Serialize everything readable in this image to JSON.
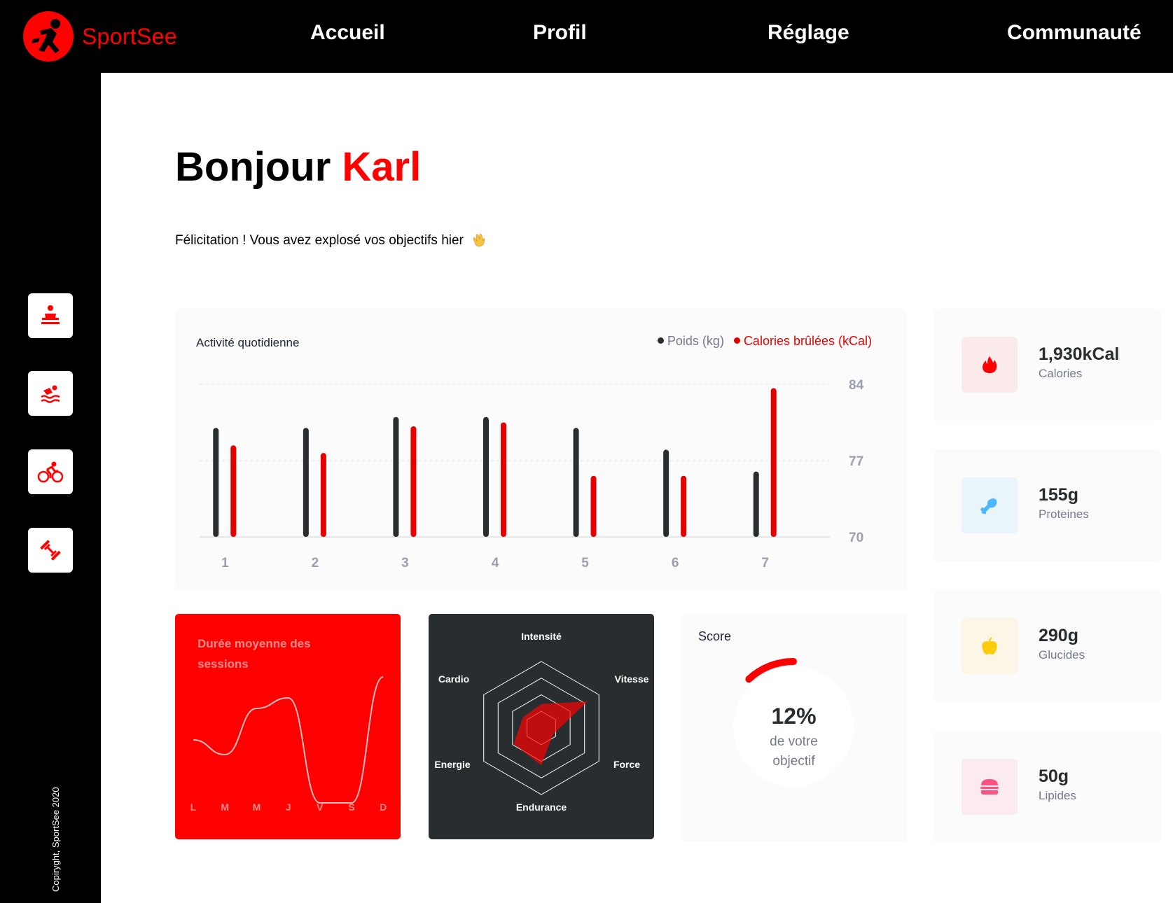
{
  "app": {
    "brand": "SportSee"
  },
  "nav": [
    {
      "label": "Accueil"
    },
    {
      "label": "Profil"
    },
    {
      "label": "Réglage"
    },
    {
      "label": "Communauté"
    }
  ],
  "sidebar": {
    "items": [
      {
        "icon": "meditation-icon"
      },
      {
        "icon": "swimming-icon"
      },
      {
        "icon": "cycling-icon"
      },
      {
        "icon": "dumbbell-icon"
      }
    ],
    "copyright": "Copiryght, SportSee 2020"
  },
  "greeting": {
    "hello": "Bonjour ",
    "name": "Karl",
    "message": "Félicitation ! Vous avez explosé vos objectifs hier"
  },
  "activity": {
    "title": "Activité quotidienne",
    "legend_poids": "Poids (kg)",
    "legend_calories": "Calories brûlées (kCal)"
  },
  "sessions": {
    "title": "Durée moyenne des sessions"
  },
  "score": {
    "title": "Score",
    "value": "12%",
    "line1": "de votre",
    "line2": "objectif",
    "fraction": 0.12
  },
  "nutrients": [
    {
      "value": "1,930kCal",
      "label": "Calories",
      "icon": "flame-icon",
      "bg": "#fbeaea",
      "color": "#ff0000"
    },
    {
      "value": "155g",
      "label": "Proteines",
      "icon": "chicken-icon",
      "bg": "#e9f4fb",
      "color": "#4ab8ff"
    },
    {
      "value": "290g",
      "label": "Glucides",
      "icon": "apple-icon",
      "bg": "#fbf6e5",
      "color": "#fdcc0c"
    },
    {
      "value": "50g",
      "label": "Lipides",
      "icon": "burger-icon",
      "bg": "#fbeaef",
      "color": "#fd5181"
    }
  ],
  "colors": {
    "accent": "#ff0101",
    "dark": "#282d30",
    "poids": "#282d30",
    "calories": "#e60000"
  },
  "chart_data": [
    {
      "type": "bar",
      "title": "Activité quotidienne",
      "categories": [
        "1",
        "2",
        "3",
        "4",
        "5",
        "6",
        "7"
      ],
      "series": [
        {
          "name": "Poids (kg)",
          "values": [
            80,
            80,
            81,
            81,
            80,
            78,
            76
          ]
        },
        {
          "name": "Calories brûlées (kCal)",
          "values": [
            240,
            220,
            290,
            300,
            160,
            160,
            390
          ]
        }
      ],
      "y_ticks": [
        "70",
        "77",
        "84"
      ],
      "ylim": [
        70,
        84
      ],
      "calories_range": [
        0,
        400
      ],
      "grid": "horizontal dashed"
    },
    {
      "type": "line",
      "title": "Durée moyenne des sessions",
      "categories": [
        "L",
        "M",
        "M",
        "J",
        "V",
        "S",
        "D"
      ],
      "values": [
        30,
        23,
        45,
        50,
        0,
        0,
        60
      ]
    },
    {
      "type": "radar",
      "axes": [
        "Intensité",
        "Vitesse",
        "Force",
        "Endurance",
        "Energie",
        "Cardio"
      ],
      "values": [
        90,
        200,
        50,
        140,
        120,
        80
      ],
      "max": 250
    },
    {
      "type": "pie",
      "title": "Score",
      "values": [
        12,
        88
      ]
    }
  ]
}
